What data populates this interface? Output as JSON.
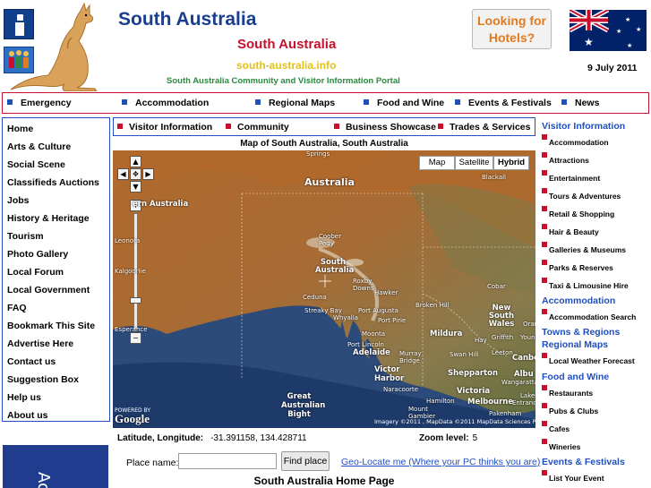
{
  "header": {
    "title": "South Australia",
    "subtitle": "South Australia",
    "url": "south-australia.info",
    "tagline": "South Australia Community and Visitor Information Portal",
    "hotels_button": "Looking for Hotels?",
    "date": "9 July 2011"
  },
  "top_nav": {
    "items": [
      "Emergency",
      "Accommodation",
      "Regional Maps",
      "Food and Wine",
      "Events & Festivals",
      "News"
    ]
  },
  "left_menu": {
    "items": [
      "Home",
      "Arts & Culture",
      "Social Scene",
      "Classifieds Auctions",
      "Jobs",
      "History & Heritage",
      "Tourism",
      "Photo Gallery",
      "Local Forum",
      "Local Government",
      "FAQ",
      "Bookmark This Site",
      "Advertise Here",
      "Contact us",
      "Suggestion Box",
      "Help us",
      "About us"
    ]
  },
  "sub_nav": {
    "items": [
      "Visitor Information",
      "Community",
      "Business Showcase",
      "Trades & Services"
    ]
  },
  "map": {
    "title": "Map of South Australia, South Australia",
    "type_buttons": [
      "Map",
      "Satellite",
      "Hybrid"
    ],
    "active_type": "Hybrid",
    "labels": {
      "springs": "Springs",
      "australia": "Australia",
      "blackall": "Blackall",
      "western_australia": "ern Australia",
      "coober_pedy": "Coober Pedy",
      "south_australia": "South Australia",
      "roxby_downs": "Roxby Downs",
      "leonora": "Leonora",
      "kalgoorlie": "Kalgoorlie",
      "hawker": "Hawker",
      "cobar": "Cobar",
      "ceduna": "Ceduna",
      "port_augusta": "Port Augusta",
      "broken_hill": "Broken Hill",
      "new_south_wales": "New South Wales",
      "orange": "Orang",
      "streaky_bay": "Streaky Bay",
      "whyalla": "Whyalla",
      "port_pirie": "Port Pirie",
      "esperance": "Esperance",
      "moonta": "Moonta",
      "mildura": "Mildura",
      "griffith": "Griffith",
      "young": "Young",
      "hay": "Hay",
      "port_lincoln": "Port Lincoln",
      "adelaide": "Adelaide",
      "murray_bridge": "Murray Bridge",
      "swan_hill": "Swan Hill",
      "leeton": "Leeton",
      "canberra": "Canbe",
      "victor_harbor": "Victor Harbor",
      "shepparton": "Shepparton",
      "albury": "Albu",
      "wangaratta": "Wangaratta",
      "naracoorte": "Naracoorte",
      "hamilton": "Hamilton",
      "victoria": "Victoria",
      "melbourne": "Melbourne",
      "great_australian_bight": "Great Australian Bight",
      "mount_gambier": "Mount Gambier",
      "pakenham": "Pakenham",
      "lakes": "Lakes",
      "entrance": "Entrance"
    },
    "logo": "Google",
    "powered_by": "POWERED BY",
    "attribution": "Imagery ©2011 , MapData ©2011 MapData Sciences Pty Ltd, PSMA - Terms of Use"
  },
  "location": {
    "latlng_label": "Latitude, Longitude:",
    "latlng_value": "-31.391158, 134.428711",
    "zoom_label": "Zoom level:",
    "zoom_value": "5"
  },
  "search": {
    "place_label": "Place name:",
    "place_value": "",
    "find_button": "Find place",
    "geolocate_link": "Geo-Locate me (Where your PC thinks you are)"
  },
  "page_heading": "South Australia Home Page",
  "ad": {
    "text": "Ac"
  },
  "sidebar": {
    "visitor_head": "Visitor Information",
    "visitor_items": [
      "Accommodation",
      "Attractions",
      "Entertainment",
      "Tours & Adventures",
      "Retail & Shopping",
      "Hair & Beauty",
      "Galleries & Museums",
      "Parks & Reserves",
      "Taxi & Limousine Hire"
    ],
    "accommodation_head": "Accommodation",
    "accommodation_items": [
      "Accommodation Search"
    ],
    "towns_head": "Towns & Regions",
    "regional_head": "Regional Maps",
    "regional_items": [
      "Local Weather Forecast"
    ],
    "food_head": "Food and Wine",
    "food_items": [
      "Restaurants",
      "Pubs & Clubs",
      "Cafes",
      "Wineries"
    ],
    "events_head": "Events & Festivals",
    "events_items": [
      "List Your Event"
    ]
  },
  "colors": {
    "brand_blue": "#1a3e8f",
    "brand_red": "#c8102e",
    "url_yellow": "#e5c214",
    "tagline_green": "#2b8a3e",
    "hotel_orange": "#e07b20"
  }
}
